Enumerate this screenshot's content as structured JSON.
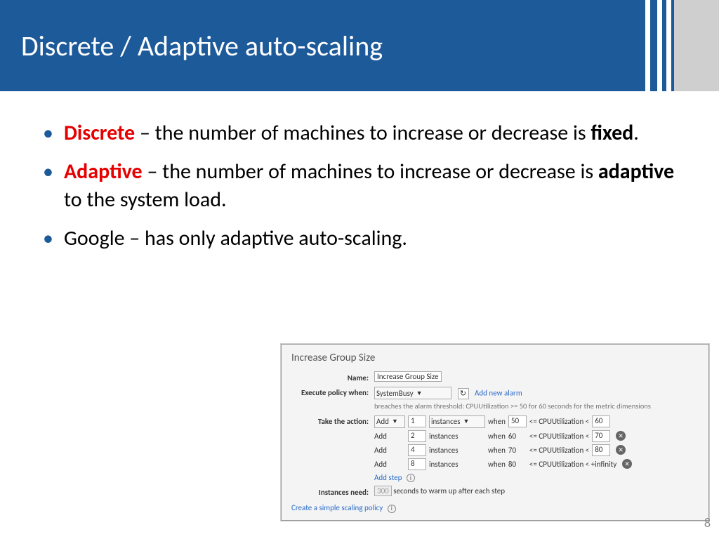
{
  "slide": {
    "title": "Discrete / Adaptive auto-scaling",
    "page_number": "8"
  },
  "bullets": {
    "b1_kw": "Discrete",
    "b1_rest_a": " – the number of machines to increase or decrease is ",
    "b1_bold": "fixed",
    "b1_rest_b": ".",
    "b2_kw": "Adaptive",
    "b2_rest_a": " – the number of machines to increase or decrease is ",
    "b2_bold": "adaptive",
    "b2_rest_b": " to the system load.",
    "b3": "Google – has only adaptive auto-scaling."
  },
  "panel": {
    "title": "Increase Group Size",
    "labels": {
      "name": "Name:",
      "execute": "Execute policy when:",
      "action": "Take the action:",
      "instances_need": "Instances need:"
    },
    "name_value": "Increase Group Size",
    "policy_select": "SystemBusy",
    "add_alarm": "Add new alarm",
    "breach_text": "breaches the alarm threshold: CPUUtilization >= 50 for 60 seconds for the metric dimensions",
    "action_select": "Add",
    "unit_select": "instances",
    "when": "when",
    "cpu_lbl": " <= CPUUtilization < ",
    "cpu_inf": " <= CPUUtilization < +infinity",
    "steps": [
      {
        "op": "Add",
        "count": "1",
        "when_val": "50",
        "cpu_upper": "60",
        "removable": false,
        "op_dropdown": true,
        "unit_dropdown": true,
        "when_is_input": true
      },
      {
        "op": "Add",
        "count": "2",
        "when_val": "60",
        "cpu_upper": "70",
        "removable": true
      },
      {
        "op": "Add",
        "count": "4",
        "when_val": "70",
        "cpu_upper": "80",
        "removable": true
      },
      {
        "op": "Add",
        "count": "8",
        "when_val": "80",
        "cpu_upper": "+infinity",
        "removable": true
      }
    ],
    "add_step": "Add step",
    "warmup_value": "300",
    "warmup_text": "seconds to warm up after each step",
    "simple_link": "Create a simple scaling policy"
  }
}
